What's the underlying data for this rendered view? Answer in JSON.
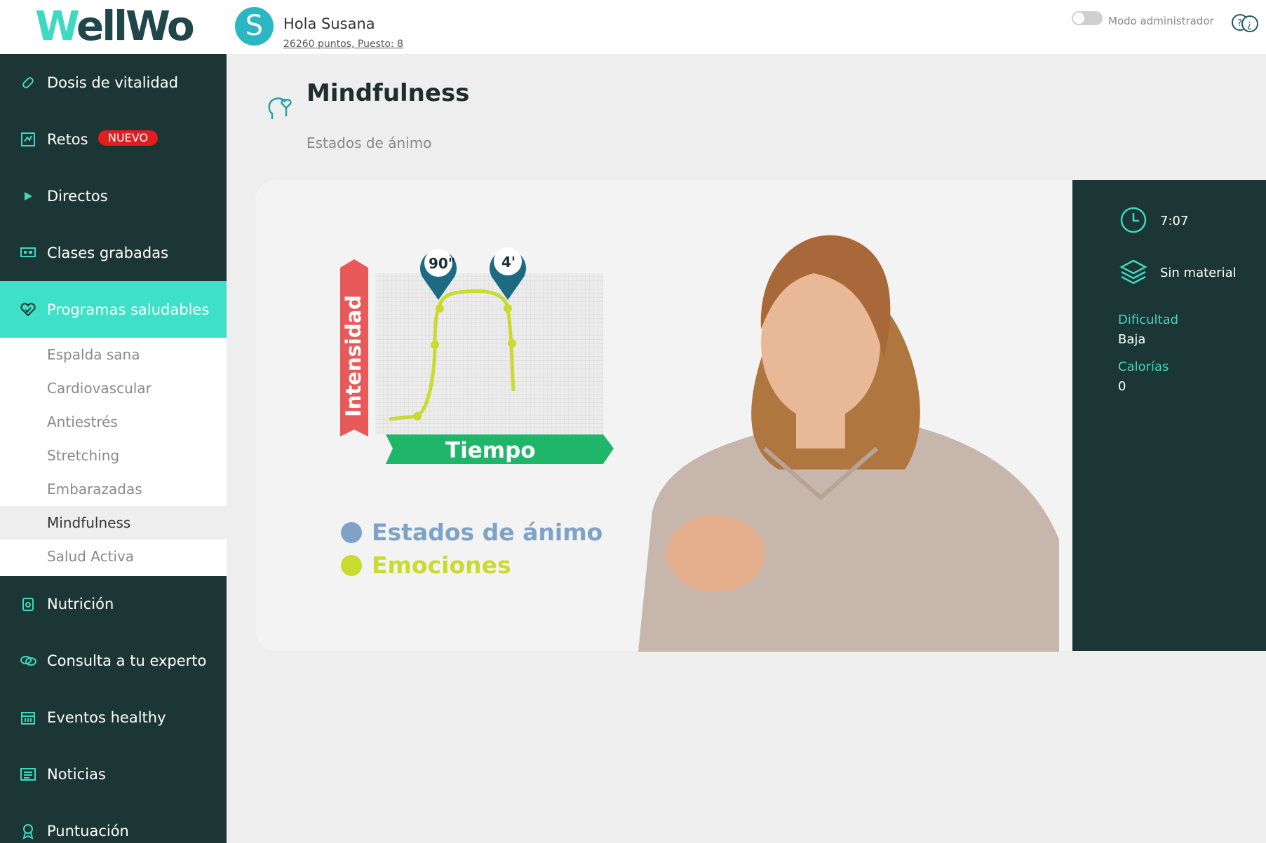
{
  "header": {
    "logo_w": "W",
    "logo_rest": "ellWo",
    "avatar_letter": "S",
    "greeting": "Hola Susana",
    "points": "26260 puntos, Puesto: 8",
    "admin_label": "Modo administrador"
  },
  "sidebar": {
    "items": [
      {
        "label": "Dosis de vitalidad",
        "icon": "pill-icon"
      },
      {
        "label": "Retos",
        "icon": "challenge-icon",
        "badge": "NUEVO"
      },
      {
        "label": "Directos",
        "icon": "play-icon"
      },
      {
        "label": "Clases grabadas",
        "icon": "video-icon"
      },
      {
        "label": "Programas saludables",
        "icon": "heart-check-icon"
      },
      {
        "label": "Nutrición",
        "icon": "nutrition-icon"
      },
      {
        "label": "Consulta a tu experto",
        "icon": "chat-icon"
      },
      {
        "label": "Eventos healthy",
        "icon": "calendar-icon"
      },
      {
        "label": "Noticias",
        "icon": "news-icon"
      },
      {
        "label": "Puntuación",
        "icon": "award-icon"
      }
    ],
    "submenu": [
      {
        "label": "Espalda sana"
      },
      {
        "label": "Cardiovascular"
      },
      {
        "label": "Antiestrés"
      },
      {
        "label": "Stretching"
      },
      {
        "label": "Embarazadas"
      },
      {
        "label": "Mindfulness"
      },
      {
        "label": "Salud Activa"
      }
    ]
  },
  "main": {
    "title": "Mindfulness",
    "subtitle": "Estados de ánimo"
  },
  "video": {
    "chart_y_label": "Intensidad",
    "chart_x_label": "Tiempo",
    "marker_1": "90\"",
    "marker_2": "4'",
    "legend_1": "Estados de ánimo",
    "legend_2": "Emociones",
    "colors": {
      "legend_1": "#7fa3c6",
      "legend_2": "#c9db2e",
      "x_bar": "#1fb66a",
      "y_bar": "#e85a5a"
    }
  },
  "info": {
    "duration": "7:07",
    "material": "Sin material",
    "difficulty_label": "Dificultad",
    "difficulty_value": "Baja",
    "calories_label": "Calorías",
    "calories_value": "0"
  }
}
